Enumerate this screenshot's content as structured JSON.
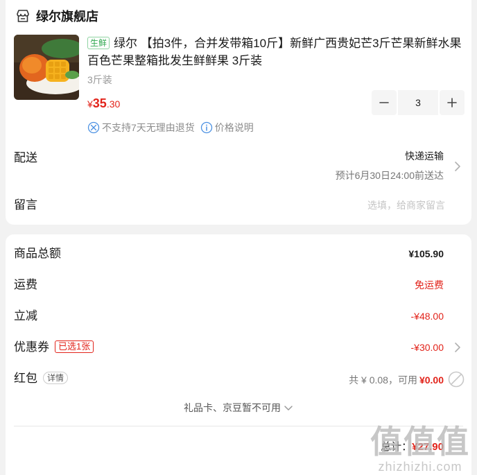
{
  "store": {
    "name": "绿尔旗舰店",
    "icon": "store-icon"
  },
  "product": {
    "tag": "生鲜",
    "title": "绿尔 【拍3件，合并发带箱10斤】新鲜广西贵妃芒3斤芒果新鲜水果百色芒果整箱批发生鲜鲜果 3斤装",
    "spec": "3斤装",
    "price_currency": "¥",
    "price_int": "35",
    "price_dec": ".30",
    "quantity": "3",
    "services": [
      {
        "icon": "no-return-icon",
        "label": "不支持7天无理由退货"
      },
      {
        "icon": "info-icon",
        "label": "价格说明"
      }
    ]
  },
  "shipping": {
    "label": "配送",
    "method": "快递运输",
    "eta": "预计6月30日24:00前送达"
  },
  "note": {
    "label": "留言",
    "placeholder": "选填，给商家留言"
  },
  "summary": {
    "goods_total_label": "商品总额",
    "goods_total_value": "¥105.90",
    "freight_label": "运费",
    "freight_value": "免运费",
    "discount_label": "立减",
    "discount_value": "-¥48.00",
    "coupon_label": "优惠券",
    "coupon_tag": "已选1张",
    "coupon_value": "-¥30.00",
    "redpack_label": "红包",
    "redpack_detail": "详情",
    "redpack_total_text": "共 ¥ 0.08，可用",
    "redpack_used": "¥0.00",
    "giftcard_text": "礼品卡、京豆暂不可用",
    "total_label": "总计：",
    "total_value": "¥27.90"
  },
  "watermark": {
    "big": "值值值",
    "small": "zhizhizhi.com"
  },
  "colors": {
    "accent": "#e2231a",
    "fresh": "#2fa84f",
    "background": "#f2f2f2"
  }
}
